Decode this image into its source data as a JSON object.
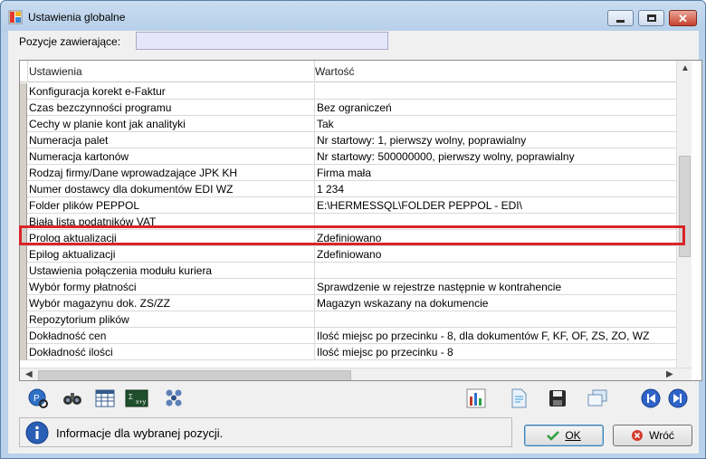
{
  "window": {
    "title": "Ustawienia globalne"
  },
  "filter": {
    "label": "Pozycje zawierające:",
    "value": ""
  },
  "grid": {
    "columns": [
      "Ustawienia",
      "Wartość"
    ],
    "rows": [
      {
        "setting": "Konfiguracja korekt e-Faktur",
        "value": ""
      },
      {
        "setting": "Czas bezczynności programu",
        "value": "Bez ograniczeń"
      },
      {
        "setting": "Cechy w planie kont jak analityki",
        "value": "Tak"
      },
      {
        "setting": "Numeracja palet",
        "value": "Nr startowy: 1, pierwszy wolny, poprawialny"
      },
      {
        "setting": "Numeracja kartonów",
        "value": "Nr startowy: 500000000, pierwszy wolny, poprawialny"
      },
      {
        "setting": "Rodzaj firmy/Dane wprowadzające JPK KH",
        "value": "Firma mała"
      },
      {
        "setting": "Numer dostawcy dla dokumentów EDI WZ",
        "value": "1 234"
      },
      {
        "setting": "Folder plików PEPPOL",
        "value": "E:\\HERMESSQL\\FOLDER PEPPOL - EDI\\"
      },
      {
        "setting": "Biała lista podatników VAT",
        "value": ""
      },
      {
        "setting": "Prolog aktualizacji",
        "value": "Zdefiniowano"
      },
      {
        "setting": "Epilog aktualizacji",
        "value": "Zdefiniowano"
      },
      {
        "setting": "Ustawienia połączenia modułu kuriera",
        "value": ""
      },
      {
        "setting": "Wybór formy płatności",
        "value": "Sprawdzenie w rejestrze następnie w kontrahencie"
      },
      {
        "setting": "Wybór magazynu dok. ZS/ZZ",
        "value": "Magazyn wskazany na dokumencie"
      },
      {
        "setting": "Repozytorium plików",
        "value": ""
      },
      {
        "setting": "Dokładność cen",
        "value": "Ilość miejsc po przecinku - 8, dla dokumentów F, KF, OF, ZS, ZO, WZ"
      },
      {
        "setting": "Dokładność ilości",
        "value": "Ilość miejsc po przecinku - 8"
      }
    ],
    "highlighted_row": "Folder plików PEPPOL"
  },
  "info": {
    "text": "Informacje dla wybranej pozycji."
  },
  "buttons": {
    "ok": "OK",
    "back": "Wróć"
  },
  "colors": {
    "highlight": "#d9252a",
    "filter_bg": "#e6e6fa",
    "window_frame": "#b9d1ea"
  }
}
